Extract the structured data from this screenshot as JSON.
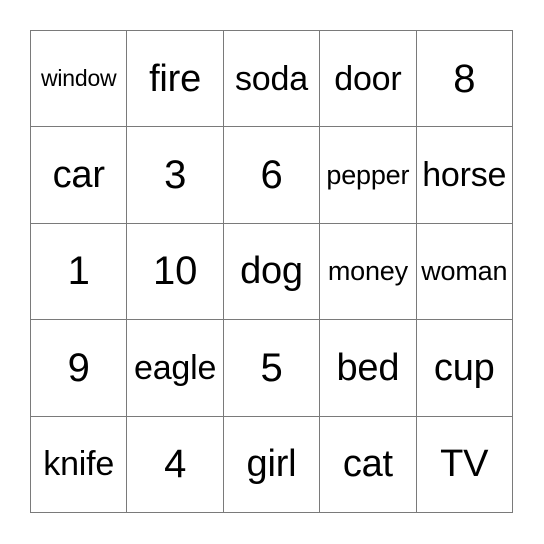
{
  "card": {
    "type": "bingo-card",
    "rows": 5,
    "columns": 5,
    "border_color": "#7a7a7a",
    "background_color": "#ffffff",
    "text_color": "#000000",
    "cells": [
      [
        {
          "text": "window",
          "size": "xs"
        },
        {
          "text": "fire",
          "size": "lg"
        },
        {
          "text": "soda",
          "size": "md"
        },
        {
          "text": "door",
          "size": "md"
        },
        {
          "text": "8",
          "size": "xl"
        }
      ],
      [
        {
          "text": "car",
          "size": "lg"
        },
        {
          "text": "3",
          "size": "xl"
        },
        {
          "text": "6",
          "size": "xl"
        },
        {
          "text": "pepper",
          "size": "sm"
        },
        {
          "text": "horse",
          "size": "md"
        }
      ],
      [
        {
          "text": "1",
          "size": "xl"
        },
        {
          "text": "10",
          "size": "xl"
        },
        {
          "text": "dog",
          "size": "lg"
        },
        {
          "text": "money",
          "size": "sm"
        },
        {
          "text": "woman",
          "size": "sm"
        }
      ],
      [
        {
          "text": "9",
          "size": "xl"
        },
        {
          "text": "eagle",
          "size": "md"
        },
        {
          "text": "5",
          "size": "xl"
        },
        {
          "text": "bed",
          "size": "lg"
        },
        {
          "text": "cup",
          "size": "lg"
        }
      ],
      [
        {
          "text": "knife",
          "size": "md"
        },
        {
          "text": "4",
          "size": "xl"
        },
        {
          "text": "girl",
          "size": "lg"
        },
        {
          "text": "cat",
          "size": "lg"
        },
        {
          "text": "TV",
          "size": "lg"
        }
      ]
    ]
  }
}
